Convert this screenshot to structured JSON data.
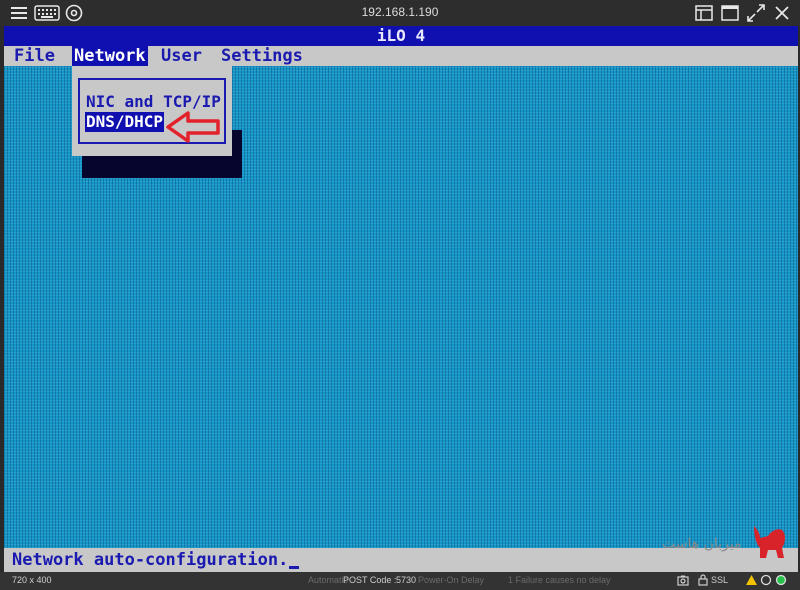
{
  "window": {
    "address": "192.168.1.190",
    "icons": [
      "menu-icon",
      "keyboard-icon",
      "disc-icon",
      "window-icon",
      "maximize-icon",
      "fullscreen-icon",
      "close-icon"
    ]
  },
  "console": {
    "title": "iLO 4",
    "menu": [
      {
        "label": "File"
      },
      {
        "label": "Network"
      },
      {
        "label": "User"
      },
      {
        "label": "Settings"
      }
    ],
    "dropdown": {
      "items": [
        {
          "label": "NIC and TCP/IP"
        },
        {
          "label": "DNS/DHCP"
        }
      ],
      "selected": "DNS/DHCP"
    },
    "status_text": "Network auto-configuration.",
    "background_color": "#1596c8",
    "highlight_color": "#1010b0",
    "annotation_color": "#e3212b"
  },
  "watermark": {
    "text": "میزبان هاست"
  },
  "statusbar": {
    "resolution": "720 x 400",
    "post_label": "POST Code :",
    "post_value": "5730",
    "faint_left": "Automatic",
    "faint_mid": "Power-On Delay",
    "faint_right": "1 Failure causes no delay",
    "ssl": "SSL"
  }
}
